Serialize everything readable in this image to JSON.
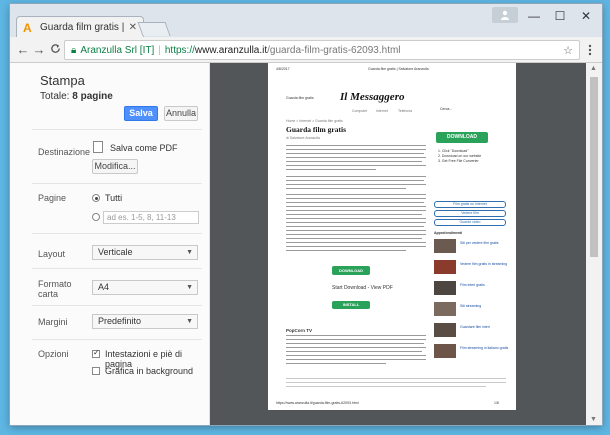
{
  "browser": {
    "tab_title": "Guarda film gratis | Salva",
    "tab_close": "✕",
    "minimize": "—",
    "maximize": "☐",
    "close": "✕",
    "profile_icon": "person-icon"
  },
  "toolbar": {
    "back": "←",
    "forward": "→",
    "reload": "C",
    "site_name": "Aranzulla Srl [IT]",
    "scheme": "https://",
    "host": "www.aranzulla.it",
    "path": "/guarda-film-gratis-62093.html",
    "star": "☆",
    "menu": "⋮"
  },
  "print_panel": {
    "title": "Stampa",
    "total_label": "Totale:",
    "total_value": "8 pagine",
    "save_button": "Salva",
    "cancel_button": "Annulla",
    "destination_label": "Destinazione",
    "destination_value": "Salva come PDF",
    "modify_button": "Modifica...",
    "pages_label": "Pagine",
    "pages_all": "Tutti",
    "pages_placeholder": "ad es. 1-5, 8, 11-13",
    "layout_label": "Layout",
    "layout_value": "Verticale",
    "paper_label_line1": "Formato",
    "paper_label_line2": "carta",
    "paper_value": "A4",
    "margins_label": "Margini",
    "margins_value": "Predefinito",
    "options_label": "Opzioni",
    "option_headers": "Intestazioni e piè di pagina",
    "option_headers_checked": true,
    "option_graphics": "Grafica in background",
    "option_graphics_checked": false
  },
  "preview_page": {
    "header_date": "4/8/2017",
    "header_title": "Guarda film gratis | Salvatore Aranzulla",
    "promo_text": "Guarda film gratis",
    "logo_text": "Il Messaggero",
    "nav_items": [
      "Computer",
      "Internet",
      "Telefonia"
    ],
    "search_label": "Cerca...",
    "breadcrumb": "Home > Internet > Guarda film gratis",
    "article_title": "Guarda film gratis",
    "byline": "di Salvatore Aranzulla",
    "download_label": "DOWNLOAD",
    "download_small": "DOWNLOAD",
    "start_download": "Start Download - View PDF",
    "install_label": "INSTALL",
    "section_popcorn": "PopCorn TV",
    "sidebar_buttons": [
      "Film gratis su Internet",
      "Vedere film",
      "Guarde video"
    ],
    "sidebar_heading": "Approfondimenti",
    "sidebar_links": [
      "Siti per vedere film gratis",
      "Vedere film gratis in streaming",
      "Film interi gratis",
      "Siti streaming",
      "Guardare film interi",
      "Film streaming in italiano gratis"
    ],
    "steps": [
      "1. Click \"Download\"",
      "2. Download on our website",
      "3. Get Free File Converter"
    ],
    "footer_url": "https://www.aranzulla.it/guarda-film-gratis-62093.html",
    "footer_page": "1/8"
  }
}
